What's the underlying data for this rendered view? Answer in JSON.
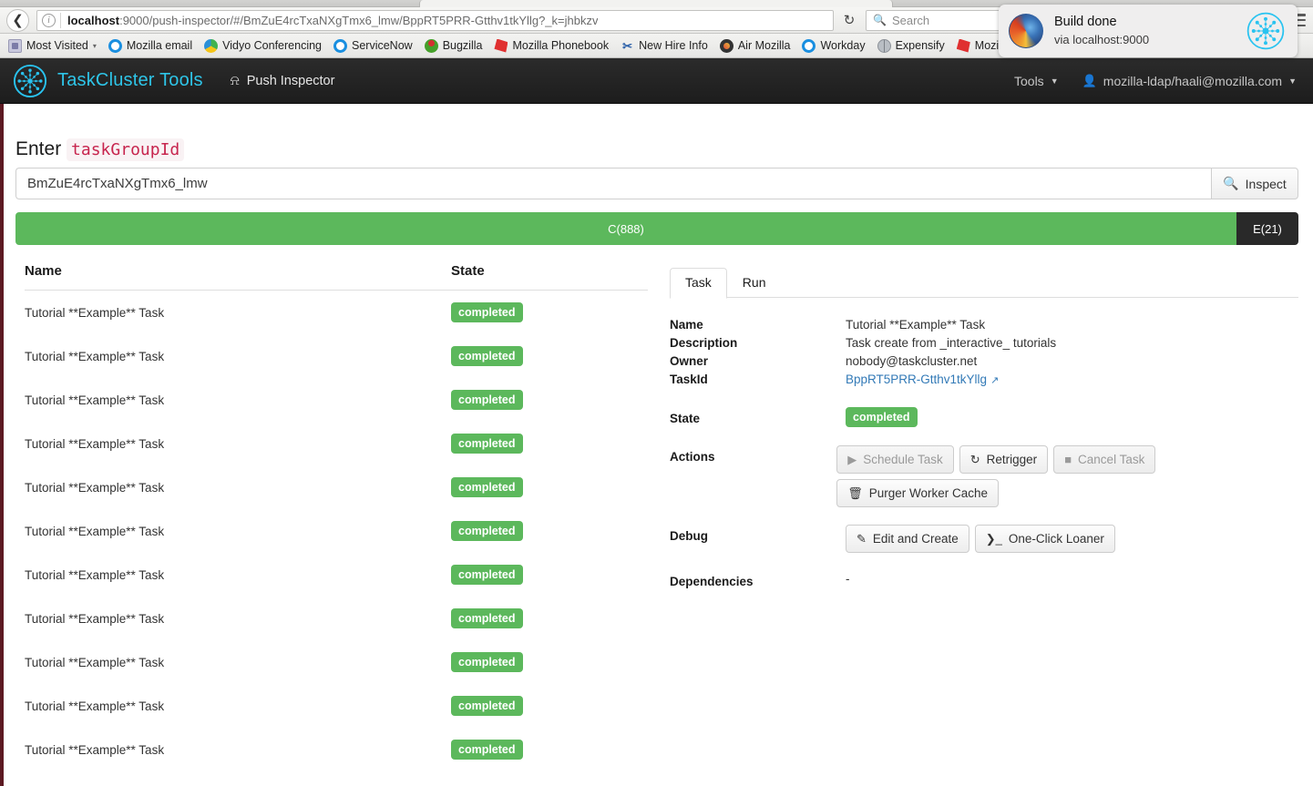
{
  "browser": {
    "back_icon": "back-arrow-icon",
    "info_icon": "info-icon",
    "url_host": "localhost",
    "url_rest": ":9000/push-inspector/#/BmZuE4rcTxaNXgTmx6_lmw/BppRT5PRR-Gtthv1tkYllg?_k=jhbkzv",
    "reload_icon": "↻",
    "search_placeholder": "Search",
    "search_icon": "search-icon",
    "menu_icon": "hamburger-icon",
    "bookmarks": [
      {
        "label": "Most Visited",
        "icon": "folder-icon",
        "caret": "▾"
      },
      {
        "label": "Mozilla email",
        "icon": "ring-icon",
        "caret": ""
      },
      {
        "label": "Vidyo Conferencing",
        "icon": "vidyo-icon",
        "caret": ""
      },
      {
        "label": "ServiceNow",
        "icon": "ring-icon",
        "caret": ""
      },
      {
        "label": "Bugzilla",
        "icon": "bug-icon",
        "caret": ""
      },
      {
        "label": "Mozilla Phonebook",
        "icon": "dino-icon",
        "caret": ""
      },
      {
        "label": "New Hire Info",
        "icon": "scissors-icon",
        "caret": ""
      },
      {
        "label": "Air Mozilla",
        "icon": "air-mozilla-icon",
        "caret": ""
      },
      {
        "label": "Workday",
        "icon": "ring-icon",
        "caret": ""
      },
      {
        "label": "Expensify",
        "icon": "globe-icon",
        "caret": ""
      },
      {
        "label": "Mozill",
        "icon": "dino-icon",
        "caret": ""
      }
    ]
  },
  "notification": {
    "app_icon": "firefox-logo-icon",
    "title": "Build done",
    "subtitle": "via localhost:9000",
    "site_icon": "taskcluster-logo-icon"
  },
  "app_navbar": {
    "logo_icon": "taskcluster-logo-icon",
    "brand": "TaskCluster Tools",
    "nav_item_icon": "cube-icon",
    "nav_item": "Push Inspector",
    "tools_menu": "Tools",
    "tools_caret": "▾",
    "user_icon": "person-icon",
    "user": "mozilla-ldap/haali@mozilla.com",
    "user_caret": "▾"
  },
  "form": {
    "title_prefix": "Enter",
    "title_code": "taskGroupId",
    "input_value": "BmZuE4rcTxaNXgTmx6_lmw",
    "input_placeholder": "",
    "inspect_label": "Inspect",
    "inspect_icon": "search-icon"
  },
  "progress": {
    "completed_label": "C(888)",
    "exception_label": "E(21)",
    "completed_color": "#5cb85c",
    "exception_color": "#292929",
    "completed_count": 888,
    "exception_count": 21
  },
  "task_table": {
    "col_name": "Name",
    "col_state": "State",
    "rows": [
      {
        "name": "Tutorial **Example** Task",
        "state": "completed"
      },
      {
        "name": "Tutorial **Example** Task",
        "state": "completed"
      },
      {
        "name": "Tutorial **Example** Task",
        "state": "completed"
      },
      {
        "name": "Tutorial **Example** Task",
        "state": "completed"
      },
      {
        "name": "Tutorial **Example** Task",
        "state": "completed"
      },
      {
        "name": "Tutorial **Example** Task",
        "state": "completed"
      },
      {
        "name": "Tutorial **Example** Task",
        "state": "completed"
      },
      {
        "name": "Tutorial **Example** Task",
        "state": "completed"
      },
      {
        "name": "Tutorial **Example** Task",
        "state": "completed"
      },
      {
        "name": "Tutorial **Example** Task",
        "state": "completed"
      },
      {
        "name": "Tutorial **Example** Task",
        "state": "completed"
      }
    ]
  },
  "detail": {
    "tabs": [
      {
        "label": "Task",
        "active": true
      },
      {
        "label": "Run",
        "active": false
      }
    ],
    "fields": {
      "name_label": "Name",
      "name_value": "Tutorial **Example** Task",
      "description_label": "Description",
      "description_value": "Task create from _interactive_ tutorials",
      "owner_label": "Owner",
      "owner_value": "nobody@taskcluster.net",
      "taskid_label": "TaskId",
      "taskid_value": "BppRT5PRR-Gtthv1tkYllg",
      "taskid_external_icon": "external-link-icon",
      "state_label": "State",
      "state_value": "completed",
      "actions_label": "Actions",
      "debug_label": "Debug",
      "dependencies_label": "Dependencies",
      "dependencies_value": "-"
    },
    "actions": [
      {
        "label": "Schedule Task",
        "icon": "play-icon",
        "glyph": "▶",
        "disabled": true
      },
      {
        "label": "Retrigger",
        "icon": "refresh-icon",
        "glyph": "↻",
        "disabled": false
      },
      {
        "label": "Cancel Task",
        "icon": "stop-icon",
        "glyph": "■",
        "disabled": true
      },
      {
        "label": "Purger Worker Cache",
        "icon": "trash-icon",
        "glyph": "🗑",
        "disabled": false
      }
    ],
    "debug_buttons": [
      {
        "label": "Edit and Create",
        "icon": "edit-icon",
        "glyph": "✎",
        "disabled": false
      },
      {
        "label": "One-Click Loaner",
        "icon": "terminal-icon",
        "glyph": "❯_",
        "disabled": false
      }
    ]
  },
  "colors": {
    "brand_cyan": "#2ec5e8",
    "success_green": "#5cb85c",
    "link_blue": "#337ab7",
    "code_red": "#c7254e",
    "navbar_dark": "#222222"
  }
}
